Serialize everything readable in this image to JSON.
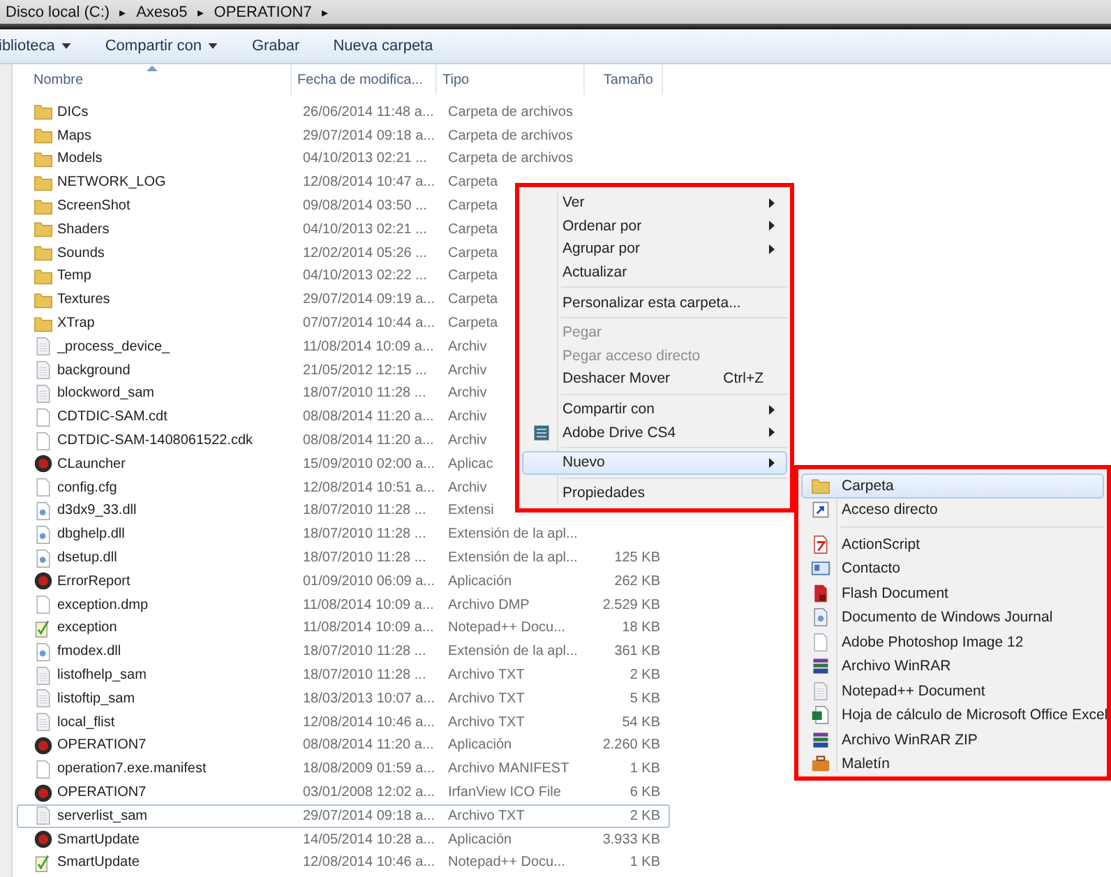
{
  "address": {
    "crumbs": [
      "Disco local (C:)",
      "Axeso5",
      "OPERATION7"
    ],
    "separator": "▸"
  },
  "toolbar": [
    {
      "label": "iblioteca",
      "dropdown": true
    },
    {
      "label": "Compartir con",
      "dropdown": true
    },
    {
      "label": "Grabar",
      "dropdown": false
    },
    {
      "label": "Nueva carpeta",
      "dropdown": false
    }
  ],
  "columns": [
    "Nombre",
    "Fecha de modifica...",
    "Tipo",
    "Tamaño"
  ],
  "rows": [
    {
      "name": "DICs",
      "date": "26/06/2014 11:48 a...",
      "type": "Carpeta de archivos",
      "kind": "folder",
      "selected": false
    },
    {
      "name": "Maps",
      "date": "29/07/2014 09:18 a...",
      "type": "Carpeta de archivos",
      "kind": "folder",
      "selected": false
    },
    {
      "name": "Models",
      "date": "04/10/2013 02:21 ...",
      "type": "Carpeta de archivos",
      "kind": "folder",
      "selected": false
    },
    {
      "name": "NETWORK_LOG",
      "date": "12/08/2014 10:47 a...",
      "type": "Carpeta",
      "kind": "folder",
      "selected": false
    },
    {
      "name": "ScreenShot",
      "date": "09/08/2014 03:50 ...",
      "type": "Carpeta",
      "kind": "folder",
      "selected": false
    },
    {
      "name": "Shaders",
      "date": "04/10/2013 02:21 ...",
      "type": "Carpeta",
      "kind": "folder",
      "selected": false
    },
    {
      "name": "Sounds",
      "date": "12/02/2014 05:26 ...",
      "type": "Carpeta",
      "kind": "folder",
      "selected": false
    },
    {
      "name": "Temp",
      "date": "04/10/2013 02:22 ...",
      "type": "Carpeta",
      "kind": "folder",
      "selected": false
    },
    {
      "name": "Textures",
      "date": "29/07/2014 09:19 a...",
      "type": "Carpeta",
      "kind": "folder",
      "selected": false
    },
    {
      "name": "XTrap",
      "date": "07/07/2014 10:44 a...",
      "type": "Carpeta",
      "kind": "folder",
      "selected": false
    },
    {
      "name": "_process_device_",
      "date": "11/08/2014 10:09 a...",
      "type": "Archiv",
      "kind": "text",
      "selected": false
    },
    {
      "name": "background",
      "date": "21/05/2012 12:15 ...",
      "type": "Archiv",
      "kind": "text",
      "selected": false
    },
    {
      "name": "blockword_sam",
      "date": "18/07/2010 11:28 ...",
      "type": "Archiv",
      "kind": "text",
      "selected": false
    },
    {
      "name": "CDTDIC-SAM.cdt",
      "date": "08/08/2014 11:20 a...",
      "type": "Archiv",
      "kind": "file",
      "selected": false
    },
    {
      "name": "CDTDIC-SAM-1408061522.cdk",
      "date": "08/08/2014 11:20 a...",
      "type": "Archiv",
      "kind": "file",
      "selected": false
    },
    {
      "name": "CLauncher",
      "date": "15/09/2010 02:00 a...",
      "type": "Aplicac",
      "kind": "app",
      "selected": false
    },
    {
      "name": "config.cfg",
      "date": "12/08/2014 10:51 a...",
      "type": "Archiv",
      "kind": "file",
      "selected": false
    },
    {
      "name": "d3dx9_33.dll",
      "date": "18/07/2010 11:28 ...",
      "type": "Extensi",
      "kind": "dll",
      "selected": false
    },
    {
      "name": "dbghelp.dll",
      "date": "18/07/2010 11:28 ...",
      "type": "Extensión de la apl...",
      "kind": "dll",
      "selected": false
    },
    {
      "name": "dsetup.dll",
      "date": "18/07/2010 11:28 ...",
      "type": "Extensión de la apl...",
      "size": "125 KB",
      "kind": "dll",
      "selected": false
    },
    {
      "name": "ErrorReport",
      "date": "01/09/2010 06:09 a...",
      "type": "Aplicación",
      "size": "262 KB",
      "kind": "app",
      "selected": false
    },
    {
      "name": "exception.dmp",
      "date": "11/08/2014 10:09 a...",
      "type": "Archivo DMP",
      "size": "2.529 KB",
      "kind": "file",
      "selected": false
    },
    {
      "name": "exception",
      "date": "11/08/2014 10:09 a...",
      "type": "Notepad++ Docu...",
      "size": "18 KB",
      "kind": "notepad",
      "selected": false
    },
    {
      "name": "fmodex.dll",
      "date": "18/07/2010 11:28 ...",
      "type": "Extensión de la apl...",
      "size": "361 KB",
      "kind": "dll",
      "selected": false
    },
    {
      "name": "listofhelp_sam",
      "date": "18/07/2010 11:28 ...",
      "type": "Archivo TXT",
      "size": "2 KB",
      "kind": "text",
      "selected": false
    },
    {
      "name": "listoftip_sam",
      "date": "18/03/2013 10:07 a...",
      "type": "Archivo TXT",
      "size": "5 KB",
      "kind": "text",
      "selected": false
    },
    {
      "name": "local_flist",
      "date": "12/08/2014 10:46 a...",
      "type": "Archivo TXT",
      "size": "54 KB",
      "kind": "text",
      "selected": false
    },
    {
      "name": "OPERATION7",
      "date": "08/08/2014 11:20 a...",
      "type": "Aplicación",
      "size": "2.260 KB",
      "kind": "app",
      "selected": false
    },
    {
      "name": "operation7.exe.manifest",
      "date": "18/08/2009 01:59 a...",
      "type": "Archivo MANIFEST",
      "size": "1 KB",
      "kind": "file",
      "selected": false
    },
    {
      "name": "OPERATION7",
      "date": "03/01/2008 12:02 a...",
      "type": "IrfanView ICO File",
      "size": "6 KB",
      "kind": "app",
      "selected": false
    },
    {
      "name": "serverlist_sam",
      "date": "29/07/2014 09:18 a...",
      "type": "Archivo TXT",
      "size": "2 KB",
      "kind": "text",
      "selected": true
    },
    {
      "name": "SmartUpdate",
      "date": "14/05/2014 10:28 a...",
      "type": "Aplicación",
      "size": "3.933 KB",
      "kind": "app",
      "selected": false
    },
    {
      "name": "SmartUpdate",
      "date": "12/08/2014 10:46 a...",
      "type": "Notepad++ Docu...",
      "size": "1 KB",
      "kind": "notepad",
      "selected": false
    }
  ],
  "context_menu": {
    "items": [
      {
        "label": "Ver",
        "kind": "text",
        "submenu": true,
        "disabled": false,
        "selected": false
      },
      {
        "label": "Ordenar por",
        "kind": "text",
        "submenu": true,
        "disabled": false,
        "selected": false
      },
      {
        "label": "Agrupar por",
        "kind": "text",
        "submenu": true,
        "disabled": false,
        "selected": false
      },
      {
        "label": "Actualizar",
        "kind": "text",
        "submenu": false,
        "disabled": false,
        "selected": false
      },
      {
        "label": "Personalizar esta carpeta...",
        "kind": "text",
        "submenu": false,
        "disabled": false,
        "selected": false,
        "separator_before": true
      },
      {
        "label": "Pegar",
        "kind": "text",
        "submenu": false,
        "disabled": true,
        "selected": false,
        "separator_before": true
      },
      {
        "label": "Pegar acceso directo",
        "kind": "text",
        "submenu": false,
        "disabled": true,
        "selected": false
      },
      {
        "label": "Deshacer Mover",
        "kind": "text",
        "shortcut": "Ctrl+Z",
        "submenu": false,
        "disabled": false,
        "selected": false
      },
      {
        "label": "Compartir con",
        "kind": "text",
        "submenu": true,
        "disabled": false,
        "selected": false,
        "separator_before": true
      },
      {
        "label": "Adobe Drive CS4",
        "kind": "drive",
        "submenu": true,
        "disabled": false,
        "selected": false
      },
      {
        "label": "Nuevo",
        "kind": "text",
        "submenu": true,
        "disabled": false,
        "selected": true,
        "separator_before": true
      },
      {
        "label": "Propiedades",
        "kind": "text",
        "submenu": false,
        "disabled": false,
        "selected": false,
        "separator_before": true
      }
    ]
  },
  "new_submenu": {
    "items": [
      {
        "label": "Carpeta",
        "kind": "folder",
        "selected": true
      },
      {
        "label": "Acceso directo",
        "kind": "shortcut",
        "selected": false
      },
      {
        "label": "ActionScript",
        "kind": "actionscript",
        "selected": false,
        "separator_before": true
      },
      {
        "label": "Contacto",
        "kind": "contact",
        "selected": false
      },
      {
        "label": "Flash Document",
        "kind": "flash",
        "selected": false
      },
      {
        "label": "Documento de Windows Journal",
        "kind": "journal",
        "selected": false
      },
      {
        "label": "Adobe Photoshop Image 12",
        "kind": "blank",
        "selected": false
      },
      {
        "label": "Archivo WinRAR",
        "kind": "rar",
        "selected": false
      },
      {
        "label": "Notepad++ Document",
        "kind": "text",
        "selected": false
      },
      {
        "label": "Hoja de cálculo de Microsoft Office Excel",
        "kind": "excel",
        "selected": false
      },
      {
        "label": "Archivo WinRAR ZIP",
        "kind": "rar",
        "selected": false
      },
      {
        "label": "Maletín",
        "kind": "briefcase",
        "selected": false
      }
    ]
  }
}
